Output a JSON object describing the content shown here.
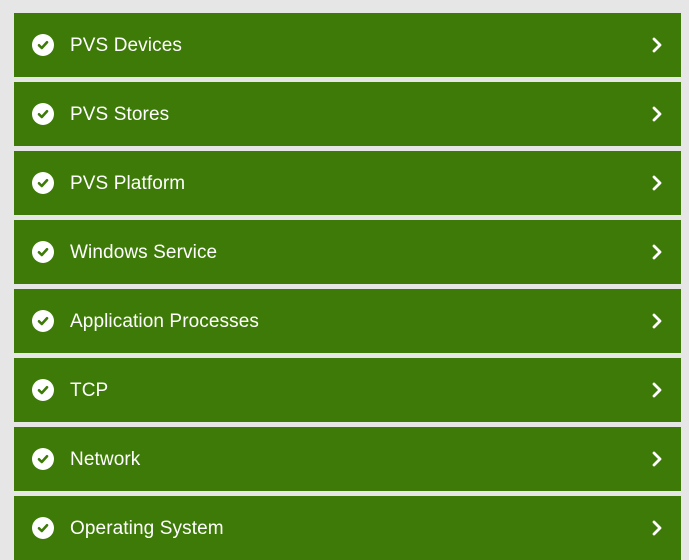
{
  "theme": {
    "row_color": "#3d7a07",
    "background": "#e6e6e6",
    "text_color": "#ffffff"
  },
  "items": [
    {
      "label": "PVS Devices",
      "status_icon": "check-circle-icon",
      "action_icon": "chevron-right-icon"
    },
    {
      "label": "PVS Stores",
      "status_icon": "check-circle-icon",
      "action_icon": "chevron-right-icon"
    },
    {
      "label": "PVS Platform",
      "status_icon": "check-circle-icon",
      "action_icon": "chevron-right-icon"
    },
    {
      "label": "Windows Service",
      "status_icon": "check-circle-icon",
      "action_icon": "chevron-right-icon"
    },
    {
      "label": "Application Processes",
      "status_icon": "check-circle-icon",
      "action_icon": "chevron-right-icon"
    },
    {
      "label": "TCP",
      "status_icon": "check-circle-icon",
      "action_icon": "chevron-right-icon"
    },
    {
      "label": "Network",
      "status_icon": "check-circle-icon",
      "action_icon": "chevron-right-icon"
    },
    {
      "label": "Operating System",
      "status_icon": "check-circle-icon",
      "action_icon": "chevron-right-icon"
    }
  ]
}
